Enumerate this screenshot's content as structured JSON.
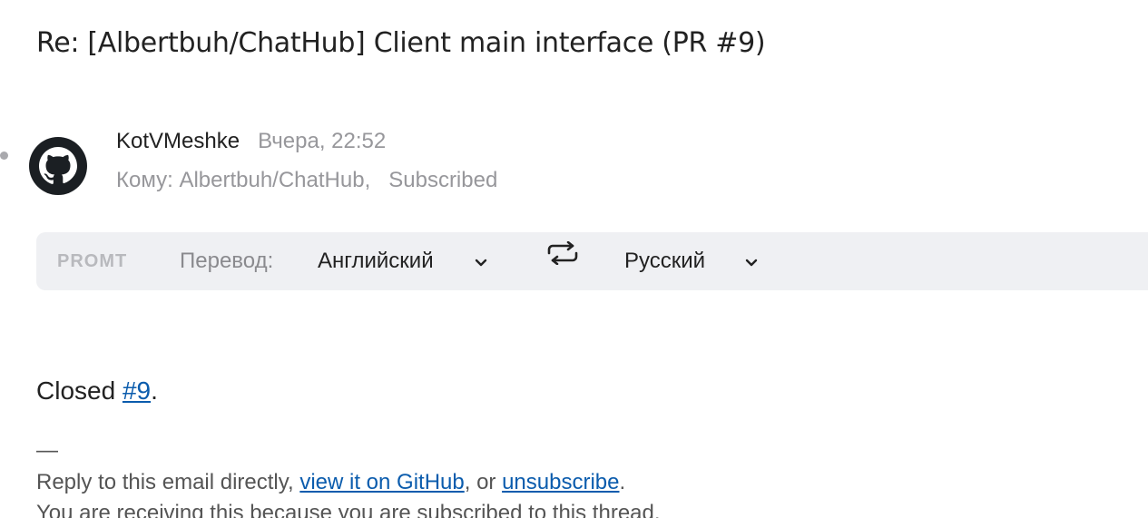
{
  "email": {
    "subject": "Re: [Albertbuh/ChatHub] Client main interface (PR #9)",
    "sender_name": "KotVMeshke",
    "sent_time": "Вчера, 22:52",
    "to_label": "Кому:",
    "to_recipient": "Albertbuh/ChatHub,",
    "to_subscribed": "Subscribed",
    "avatar_icon": "github-icon"
  },
  "translate_bar": {
    "brand": "PROMT",
    "label": "Перевод:",
    "from_language": "Английский",
    "to_language": "Русский",
    "swap_icon": "swap-arrows-icon",
    "chevron_icon": "chevron-down-icon"
  },
  "body": {
    "closed_text": "Closed ",
    "pr_link": "#9",
    "period": "."
  },
  "footer": {
    "separator": "—",
    "reply_text": "Reply to this email directly, ",
    "view_link": "view it on GitHub",
    "or_text": ", or ",
    "unsubscribe_link": "unsubscribe",
    "end_period": ".",
    "receiving_text": "You are receiving this because you are subscribed to this thread."
  },
  "colors": {
    "link": "#0b5cad",
    "muted": "#97979b",
    "bar_background": "#eff0f3"
  }
}
